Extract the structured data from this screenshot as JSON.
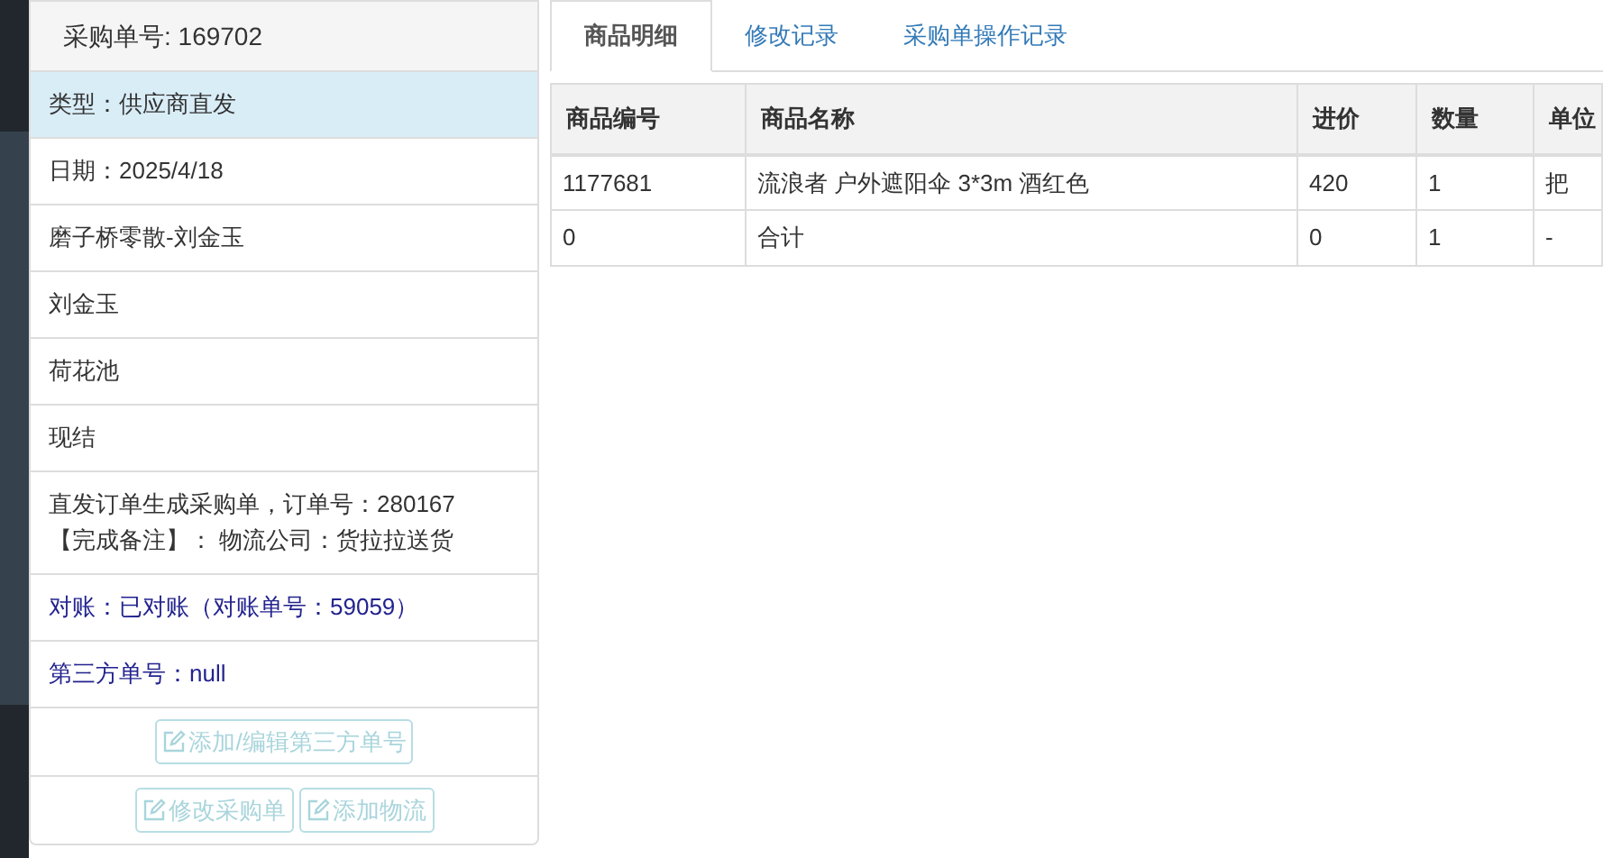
{
  "panel": {
    "title": "采购单号: 169702",
    "items": [
      {
        "text": "类型：供应商直发",
        "selected": true,
        "kind": "plain"
      },
      {
        "text": "日期：2025/4/18",
        "selected": false,
        "kind": "plain"
      },
      {
        "text": "磨子桥零散-刘金玉",
        "selected": false,
        "kind": "plain"
      },
      {
        "text": "刘金玉",
        "selected": false,
        "kind": "plain"
      },
      {
        "text": "荷花池",
        "selected": false,
        "kind": "plain"
      },
      {
        "text": "现结",
        "selected": false,
        "kind": "plain"
      },
      {
        "text": "直发订单生成采购单，订单号：280167\n【完成备注】： 物流公司：货拉拉送货",
        "selected": false,
        "kind": "plain"
      },
      {
        "text": "对账：已对账（对账单号：59059）",
        "selected": false,
        "kind": "link"
      },
      {
        "text": "第三方单号：null",
        "selected": false,
        "kind": "link"
      }
    ],
    "button_rows": [
      [
        {
          "label": "添加/编辑第三方单号",
          "disabled": true
        }
      ],
      [
        {
          "label": "修改采购单",
          "disabled": true
        },
        {
          "label": "添加物流",
          "disabled": true
        }
      ]
    ]
  },
  "tabs": [
    {
      "label": "商品明细",
      "selected": true
    },
    {
      "label": "修改记录",
      "selected": false
    },
    {
      "label": "采购单操作记录",
      "selected": false
    }
  ],
  "table": {
    "columns": [
      "商品编号",
      "商品名称",
      "进价",
      "数量",
      "单位"
    ],
    "rows": [
      [
        "1177681",
        "流浪者 户外遮阳伞 3*3m 酒红色",
        "420",
        "1",
        "把"
      ],
      [
        "0",
        "合计",
        "0",
        "1",
        "-"
      ]
    ]
  }
}
